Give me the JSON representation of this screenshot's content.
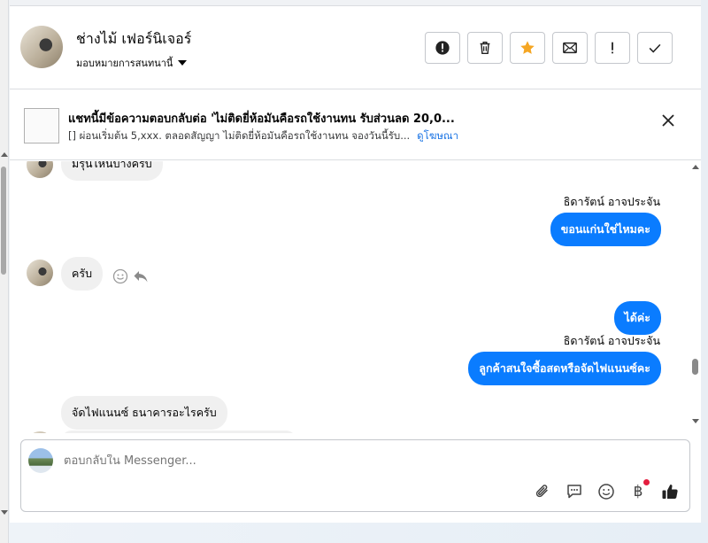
{
  "header": {
    "name": "ช่างไม้ เฟอร์นิเจอร์",
    "subtitle": "มอบหมายการสนทนานี้",
    "actions": [
      {
        "name": "report-icon"
      },
      {
        "name": "trash-icon"
      },
      {
        "name": "star-icon",
        "color": "#f5a623"
      },
      {
        "name": "mail-icon"
      },
      {
        "name": "exclamation-icon"
      },
      {
        "name": "check-icon"
      }
    ]
  },
  "ad": {
    "title": "แชทนี้มีข้อความตอบกลับต่อ 'ไม่ติดยี่ห้อมันคือรถใช้งานทน รับส่วนลด 20,0...",
    "description": "[] ผ่อนเริ่มต้น 5,xxx. ตลอดสัญญา ไม่ติดยี่ห้อมันคือรถใช้งานทน จองวันนี้รับ...",
    "sponsored_label": "ดูโฆษณา"
  },
  "messages": {
    "partial_top": "มีรุ่นไหนบ้างครับ",
    "sender_1": "ธิดารัตน์ อาจประจัน",
    "out_1": "ขอนแก่นใช่ไหมคะ",
    "in_1": "ครับ",
    "out_2": "ได้ค่ะ",
    "sender_2": "ธิดารัตน์ อาจประจัน",
    "out_3": "ลูกค้าสนใจซื้อสดหรือจัดไฟแนนซ์คะ",
    "in_2": "จัดไฟแนนซ์ ธนาคารอะไรครับ"
  },
  "composer": {
    "placeholder": "ตอบกลับใน Messenger...",
    "currency_symbol": "฿"
  },
  "colors": {
    "accent": "#0a7cff",
    "link": "#1b74e4",
    "notification": "#e41e3f"
  }
}
